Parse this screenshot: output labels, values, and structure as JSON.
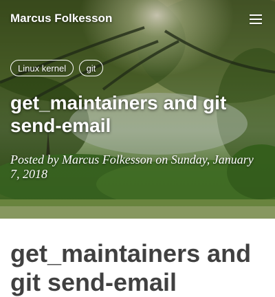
{
  "nav": {
    "brand": "Marcus Folkesson",
    "menu_icon": "hamburger-menu-icon"
  },
  "header": {
    "tags": [
      "Linux kernel",
      "git"
    ],
    "title": "get_maintainers and git send-email",
    "meta": "Posted by Marcus Folkesson on Sunday, January 7, 2018"
  },
  "content": {
    "heading": "get_maintainers and git send-email"
  },
  "colors": {
    "heading_text": "#404040",
    "hero_text": "#ffffff",
    "page_background": "#ffffff"
  }
}
